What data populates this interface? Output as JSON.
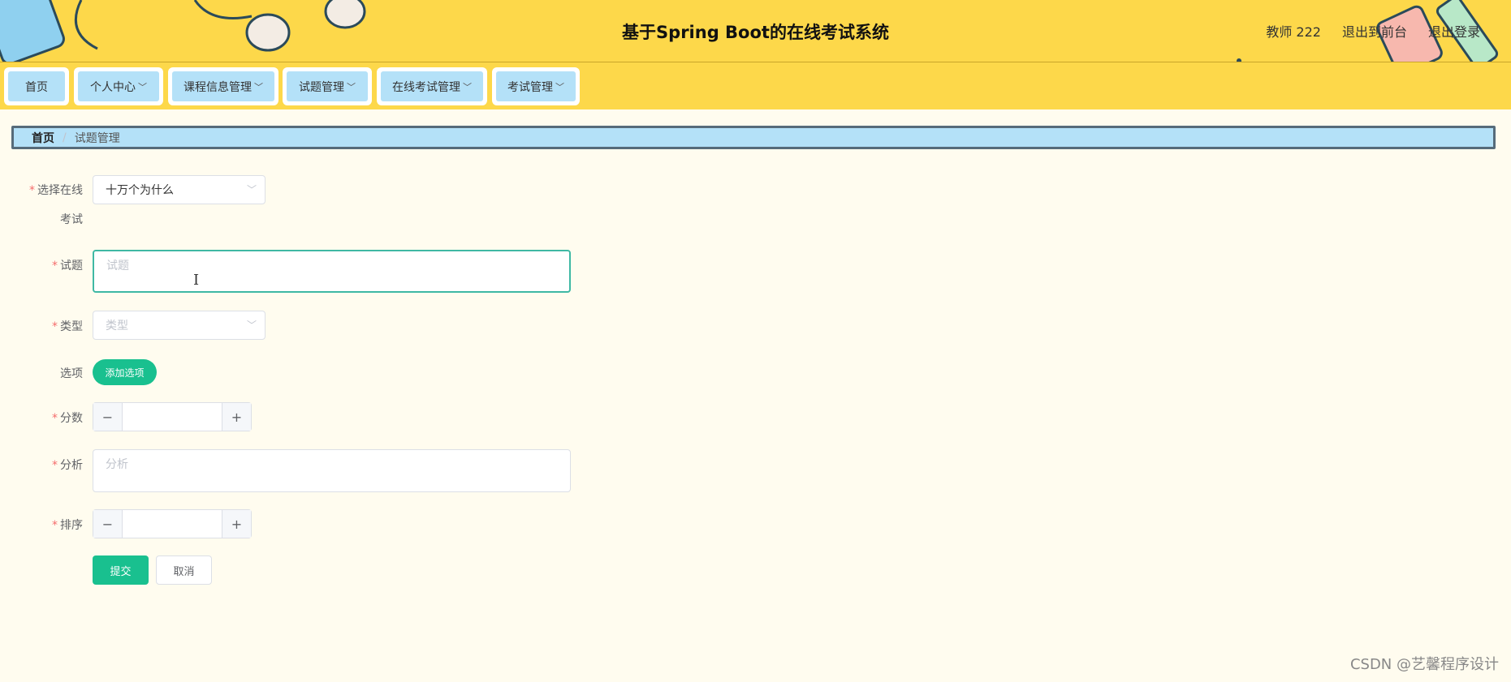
{
  "header": {
    "title": "基于Spring Boot的在线考试系统",
    "user": "教师 222",
    "to_front": "退出到前台",
    "logout": "退出登录"
  },
  "nav": [
    {
      "label": "首页",
      "dropdown": false
    },
    {
      "label": "个人中心",
      "dropdown": true
    },
    {
      "label": "课程信息管理",
      "dropdown": true
    },
    {
      "label": "试题管理",
      "dropdown": true
    },
    {
      "label": "在线考试管理",
      "dropdown": true
    },
    {
      "label": "考试管理",
      "dropdown": true
    }
  ],
  "breadcrumb": {
    "home": "首页",
    "separator": "/",
    "current": "试题管理"
  },
  "form": {
    "required_mark": "*",
    "exam_label_line1": "选择在线",
    "exam_label_line2": "考试",
    "exam_value": "十万个为什么",
    "question_label": "试题",
    "question_placeholder": "试题",
    "type_label": "类型",
    "type_placeholder": "类型",
    "options_label": "选项",
    "add_option": "添加选项",
    "score_label": "分数",
    "analysis_label": "分析",
    "analysis_placeholder": "分析",
    "order_label": "排序",
    "minus": "−",
    "plus": "+",
    "submit": "提交",
    "cancel": "取消"
  },
  "watermark": "CSDN @艺馨程序设计",
  "colors": {
    "header_bg": "#fdd84a",
    "nav_item_bg": "#b4e1f8",
    "primary": "#19c08f",
    "page_bg": "#fffcef"
  }
}
